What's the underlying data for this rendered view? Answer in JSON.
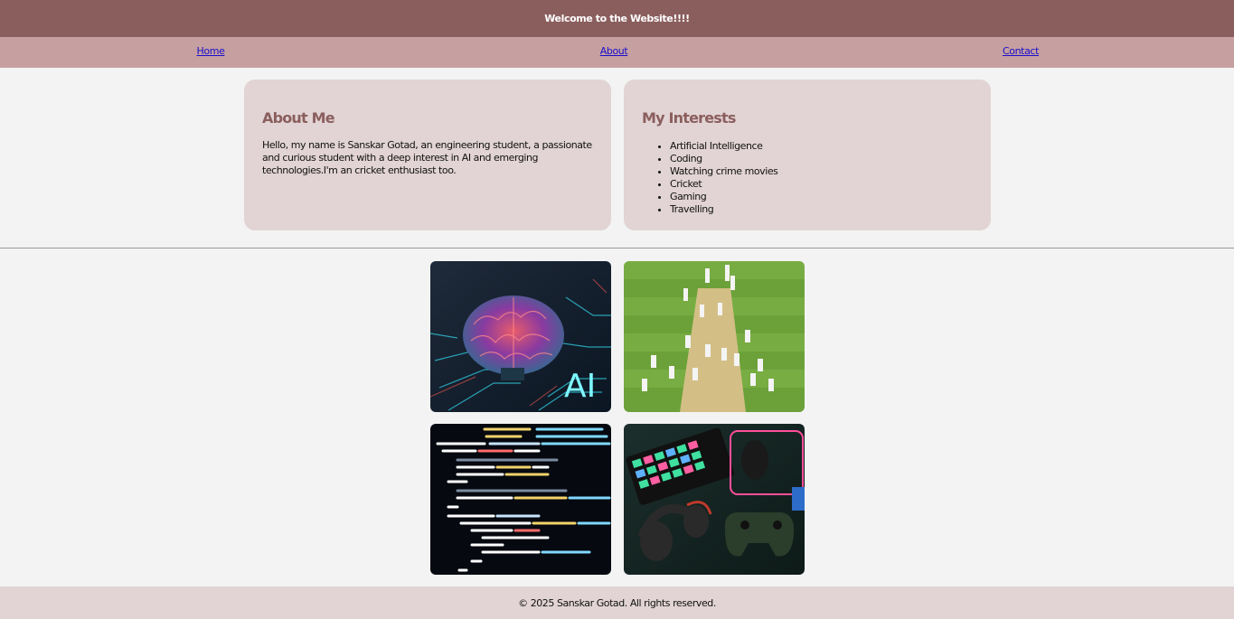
{
  "header": {
    "title": "Welcome to the Website!!!!"
  },
  "nav": {
    "items": [
      {
        "label": "Home"
      },
      {
        "label": "About"
      },
      {
        "label": "Contact"
      }
    ]
  },
  "about": {
    "heading": "About Me",
    "text": "Hello, my name is Sanskar Gotad, an engineering student, a passionate and curious student with a deep interest in AI and emerging technologies.I'm an cricket enthusiast too."
  },
  "interests": {
    "heading": "My Interests",
    "items": [
      "Artificial Intelligence",
      "Coding",
      "Watching crime movies",
      "Cricket",
      "Gaming",
      "Travelling"
    ]
  },
  "gallery": {
    "ai_image_text": "AI"
  },
  "footer": {
    "text": "© 2025 Sanskar Gotad. All rights reserved."
  }
}
